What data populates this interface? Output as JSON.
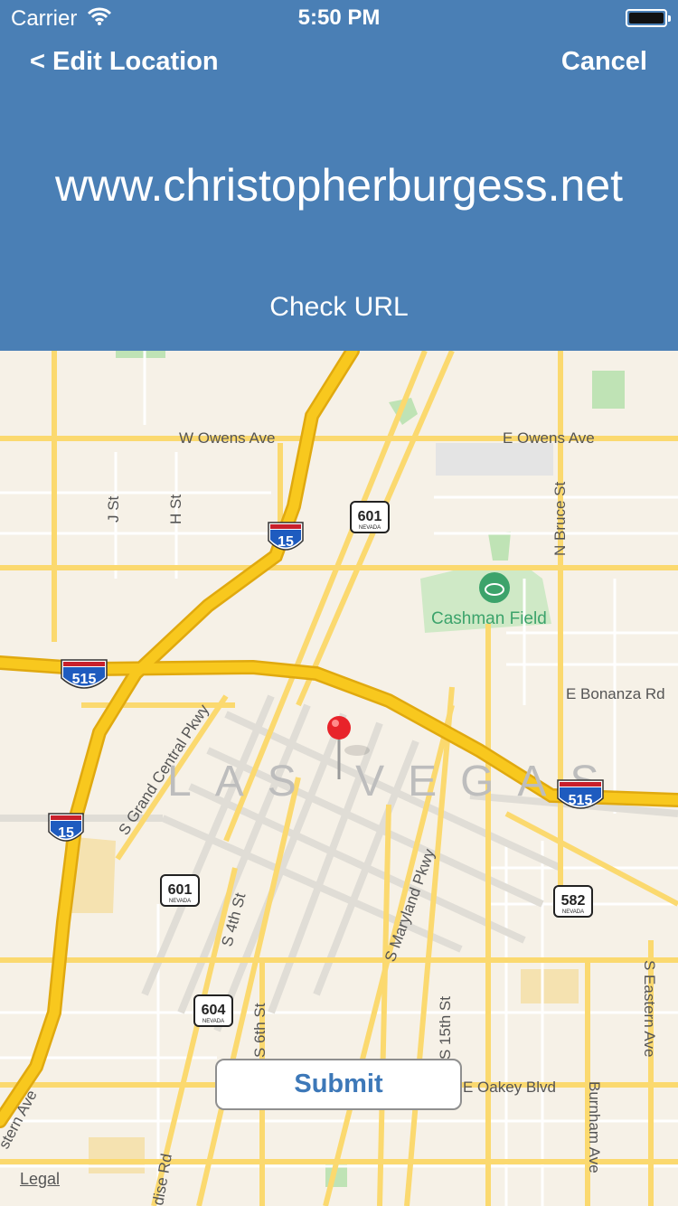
{
  "status_bar": {
    "carrier": "Carrier",
    "time": "5:50 PM"
  },
  "nav": {
    "back_label": "< Edit Location",
    "cancel_label": "Cancel"
  },
  "header": {
    "url": "www.christopherburgess.net",
    "check_url_label": "Check URL"
  },
  "map": {
    "city_label": "LAS VEGAS",
    "poi": "Cashman Field",
    "streets": {
      "w_owens": "W Owens Ave",
      "e_owens": "E Owens Ave",
      "e_bonanza": "E Bonanza Rd",
      "j_st": "J St",
      "h_st": "H St",
      "n_bruce": "N Bruce St",
      "grand_central": "S Grand Central Pkwy",
      "s_4th": "S 4th St",
      "s_6th": "S 6th St",
      "s_maryland": "S Maryland Pkwy",
      "s_15th": "S 15th St",
      "burnham": "Burnham Ave",
      "s_eastern": "S Eastern Ave",
      "e_oakey": "E Oakey Blvd",
      "eastern_partial": "stern Ave",
      "paradise_partial": "dise Rd"
    },
    "shields": {
      "i15_a": "15",
      "i15_b": "15",
      "i515_a": "515",
      "i515_b": "515",
      "nv601_a": "601",
      "nv601_b": "601",
      "nv582": "582",
      "nv604": "604",
      "state": "NEVADA"
    }
  },
  "submit_label": "Submit",
  "legal_label": "Legal",
  "colors": {
    "header_bg": "#4a7fb5",
    "submit_text": "#3d78b8",
    "freeway": "#f8c81e",
    "road": "#fbdc7c"
  }
}
